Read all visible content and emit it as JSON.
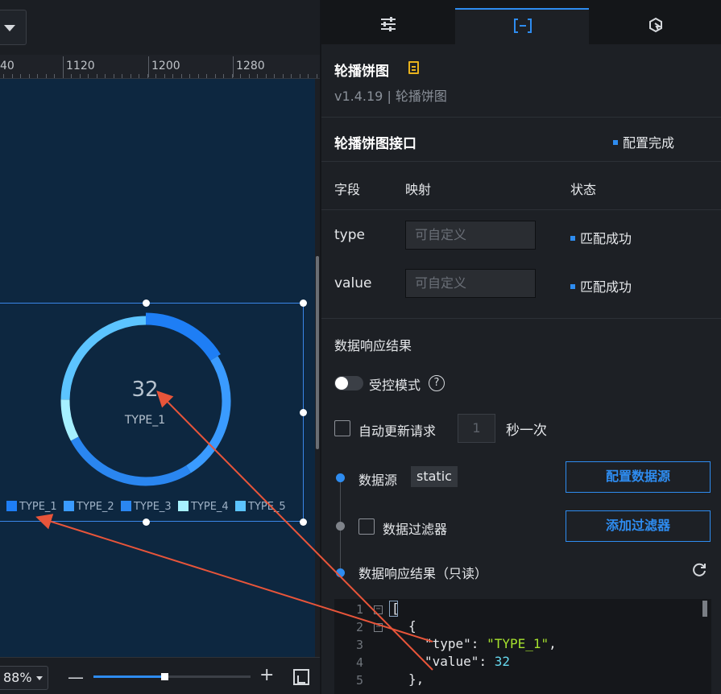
{
  "ruler": {
    "labels": [
      "40",
      "1120",
      "1200",
      "1280"
    ]
  },
  "chart_data": {
    "type": "pie",
    "categories": [
      "TYPE_1",
      "TYPE_2",
      "TYPE_3",
      "TYPE_4",
      "TYPE_5"
    ],
    "center_value": "32",
    "center_label": "TYPE_1",
    "legend_colors": [
      "#1e7ef5",
      "#3a9bff",
      "#2a86f0",
      "#a6f0ff",
      "#5cc4ff"
    ]
  },
  "zoom": {
    "value": "88%",
    "minus": "—",
    "plus": "+",
    "level": 0.45
  },
  "widget": {
    "title": "轮播饼图",
    "version": "v1.4.19 | 轮播饼图"
  },
  "api": {
    "title": "轮播饼图接口",
    "status": "配置完成",
    "headers": {
      "field": "字段",
      "mapping": "映射",
      "state": "状态"
    },
    "rows": [
      {
        "field": "type",
        "placeholder": "可自定义",
        "status": "匹配成功"
      },
      {
        "field": "value",
        "placeholder": "可自定义",
        "status": "匹配成功"
      }
    ]
  },
  "response": {
    "title": "数据响应结果",
    "controlled_label": "受控模式",
    "help": "?",
    "auto_update_label": "自动更新请求",
    "interval_value": "1",
    "interval_unit": "秒一次"
  },
  "pipeline": {
    "source_label": "数据源",
    "source_tag": "static",
    "config_source_btn": "配置数据源",
    "filter_label": "数据过滤器",
    "add_filter_btn": "添加过滤器",
    "result_label": "数据响应结果（只读）"
  },
  "code": {
    "line_numbers": [
      "1",
      "2",
      "3",
      "4",
      "5"
    ],
    "l1": "[",
    "l2": "{",
    "l3_key": "\"type\"",
    "l3_val": "\"TYPE_1\"",
    "l4_key": "\"value\"",
    "l4_val": "32",
    "l5": "},"
  },
  "colors": {
    "accent": "#2e8cf0",
    "arrow": "#e8553a"
  }
}
